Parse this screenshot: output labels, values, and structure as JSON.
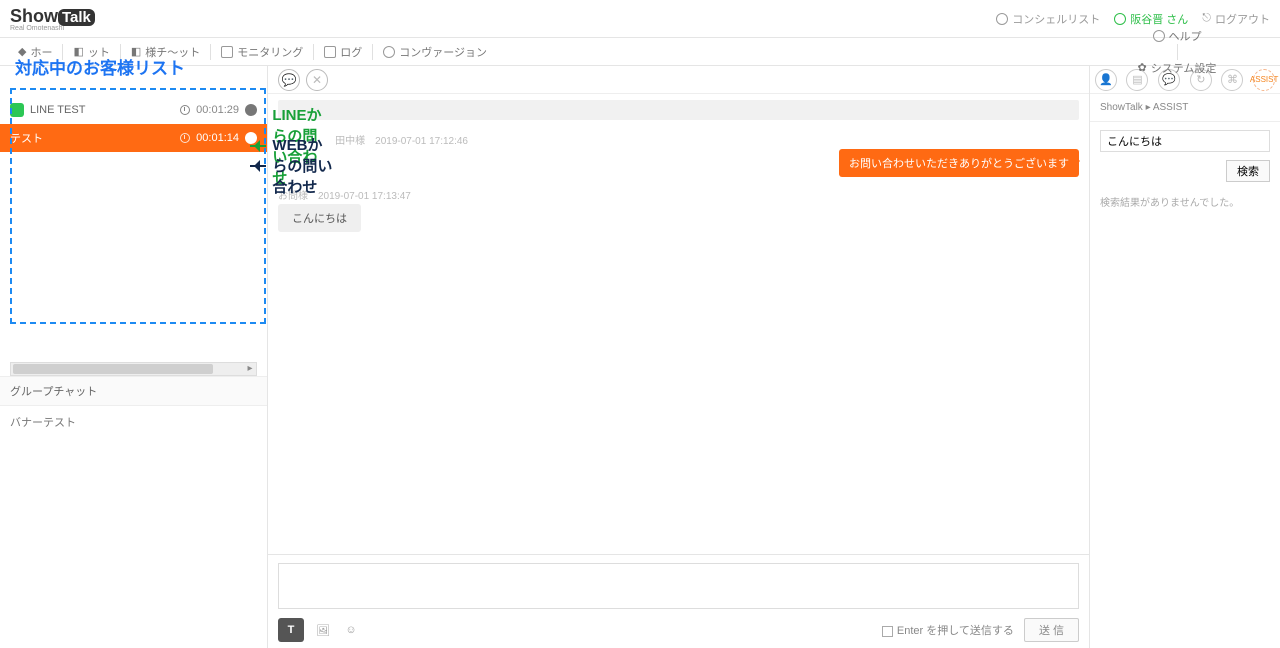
{
  "topbar": {
    "logo_main": "Show",
    "logo_talk": "Talk",
    "logo_sub": "Real Omotenashi",
    "concierge_list": "コンシェルリスト",
    "user_label": "阪谷晋 さん",
    "logout": "ログアウト"
  },
  "tabbar": {
    "tab1": "ホー",
    "tab2": "ット",
    "tab3": "様チ～ット",
    "tab4": "モニタリング",
    "tab5": "ログ",
    "tab6": "コンヴァージョン",
    "help": "ヘルプ",
    "system": "システム設定"
  },
  "annot": {
    "heading": "対応中のお客様リスト",
    "line": "LINEからの問い合わせ",
    "web": "WEBからの問い合わせ"
  },
  "left": {
    "items": [
      {
        "name": "LINE TEST",
        "time": "00:01:29"
      },
      {
        "name": "テスト",
        "time": "00:01:14"
      }
    ],
    "group_chat": "グループチャット",
    "banner_test": "バナーテスト"
  },
  "chat": {
    "op_meta": "田中様　2019-07-01 17:12:46",
    "op_bubble": "お問い合わせいただきありがとうございます",
    "cu_meta": "お問様　2019-07-01 17:13:47",
    "cu_bubble": "こんにちは"
  },
  "compose": {
    "enter_hint": "Enter を押して送信する",
    "send": "送 信"
  },
  "right": {
    "title": "ShowTalk ▸ ASSIST",
    "input_value": "こんにちは",
    "search_btn": "検索",
    "empty": "検索結果がありませんでした。"
  }
}
